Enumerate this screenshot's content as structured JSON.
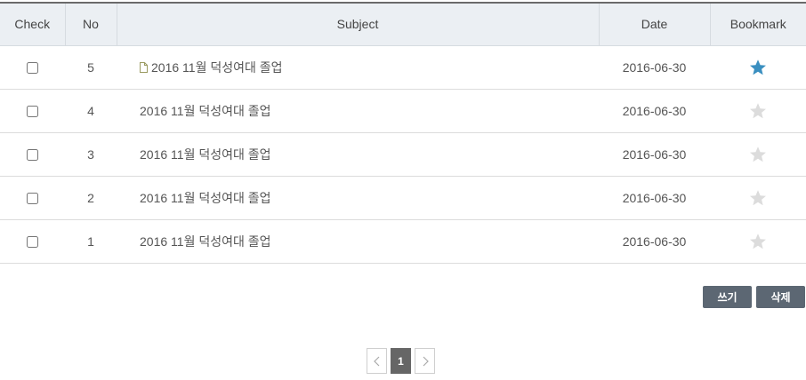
{
  "columns": {
    "check": "Check",
    "no": "No",
    "subject": "Subject",
    "date": "Date",
    "bookmark": "Bookmark"
  },
  "rows": [
    {
      "no": "5",
      "subject": "2016 11월 덕성여대 졸업",
      "date": "2016-06-30",
      "bookmarked": true,
      "new_icon": "document-icon"
    },
    {
      "no": "4",
      "subject": "2016 11월 덕성여대 졸업",
      "date": "2016-06-30",
      "bookmarked": false
    },
    {
      "no": "3",
      "subject": "2016 11월 덕성여대 졸업",
      "date": "2016-06-30",
      "bookmarked": false
    },
    {
      "no": "2",
      "subject": "2016 11월 덕성여대 졸업",
      "date": "2016-06-30",
      "bookmarked": false
    },
    {
      "no": "1",
      "subject": "2016 11월 덕성여대 졸업",
      "date": "2016-06-30",
      "bookmarked": false
    }
  ],
  "buttons": {
    "write": "쓰기",
    "delete": "삭제"
  },
  "pagination": {
    "current": "1",
    "prev_icon": "chevron-left-icon",
    "next_icon": "chevron-right-icon"
  },
  "colors": {
    "star_on": "#3a8fc0",
    "star_off": "#dcdcdc",
    "button_bg": "#5c6773",
    "header_bg": "#ebeff3"
  }
}
